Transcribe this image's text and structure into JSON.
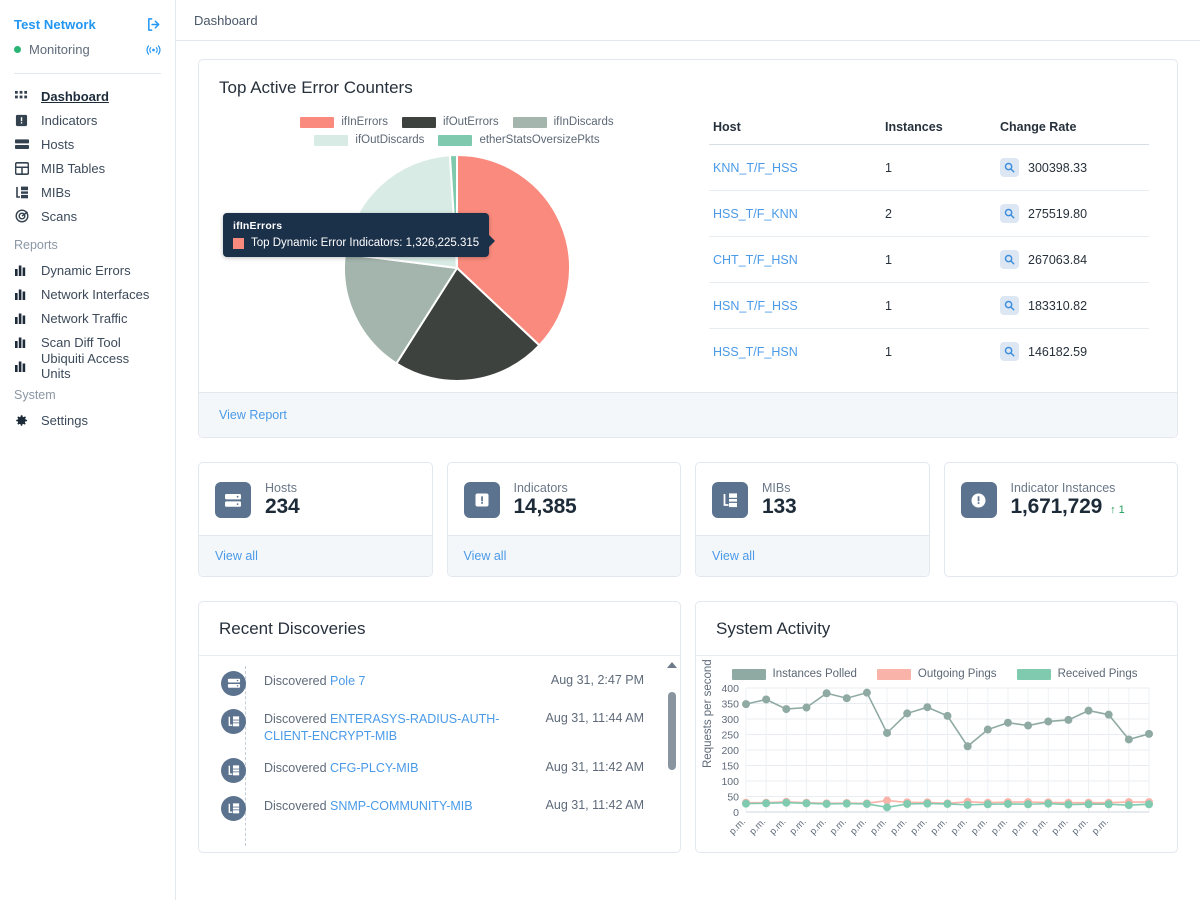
{
  "sidebar": {
    "network_name": "Test Network",
    "logout_icon": "logout-icon",
    "status_label": "Monitoring",
    "status_color": "#29b473",
    "broadcast_icon": "broadcast-icon",
    "items": [
      {
        "label": "Dashboard",
        "icon": "grid-icon",
        "active": true
      },
      {
        "label": "Indicators",
        "icon": "alert-square-icon",
        "active": false
      },
      {
        "label": "Hosts",
        "icon": "server-icon",
        "active": false
      },
      {
        "label": "MIB Tables",
        "icon": "table-icon",
        "active": false
      },
      {
        "label": "MIBs",
        "icon": "tree-icon",
        "active": false
      },
      {
        "label": "Scans",
        "icon": "radar-icon",
        "active": false
      }
    ],
    "group_reports": "Reports",
    "reports": [
      {
        "label": "Dynamic Errors",
        "icon": "bar-chart-icon"
      },
      {
        "label": "Network Interfaces",
        "icon": "bar-chart-icon"
      },
      {
        "label": "Network Traffic",
        "icon": "bar-chart-icon"
      },
      {
        "label": "Scan Diff Tool",
        "icon": "bar-chart-icon"
      },
      {
        "label": "Ubiquiti Access Units",
        "icon": "bar-chart-icon"
      }
    ],
    "group_system": "System",
    "system": [
      {
        "label": "Settings",
        "icon": "gear-icon"
      }
    ]
  },
  "topbar": {
    "breadcrumb": "Dashboard"
  },
  "error_card": {
    "title": "Top Active Error Counters",
    "view_report": "View Report",
    "table": {
      "headers": [
        "Host",
        "Instances",
        "Change Rate"
      ],
      "rows": [
        {
          "host": "KNN_T/F_HSS",
          "instances": "1",
          "rate": "300398.33"
        },
        {
          "host": "HSS_T/F_KNN",
          "instances": "2",
          "rate": "275519.80"
        },
        {
          "host": "CHT_T/F_HSN",
          "instances": "1",
          "rate": "267063.84"
        },
        {
          "host": "HSN_T/F_HSS",
          "instances": "1",
          "rate": "183310.82"
        },
        {
          "host": "HSS_T/F_HSN",
          "instances": "1",
          "rate": "146182.59"
        }
      ]
    },
    "tooltip": {
      "title": "ifInErrors",
      "text": "Top Dynamic Error Indicators: 1,326,225.315",
      "swatch": "#fa8a7d"
    }
  },
  "chart_data": [
    {
      "type": "pie",
      "title": "Top Active Error Counters",
      "legend_position": "top",
      "labels": [
        "ifInErrors",
        "ifOutErrors",
        "ifInDiscards",
        "ifOutDiscards",
        "etherStatsOversizePkts"
      ],
      "values": [
        37,
        22,
        18,
        22,
        1
      ],
      "colors": [
        "#fa8a7d",
        "#3d423f",
        "#a3b5ad",
        "#d9ebe5",
        "#7fcaae"
      ],
      "annotations": [
        "ifInErrors: Top Dynamic Error Indicators: 1,326,225.315"
      ]
    },
    {
      "type": "line",
      "title": "System Activity",
      "ylabel": "Requests per second",
      "xlabel": "",
      "ylim": [
        0,
        400
      ],
      "yticks": [
        0,
        50,
        100,
        150,
        200,
        250,
        300,
        350,
        400
      ],
      "grid": true,
      "legend_position": "top",
      "x": [
        "p.m.",
        "p.m.",
        "p.m.",
        "p.m.",
        "p.m.",
        "p.m.",
        "p.m.",
        "p.m.",
        "p.m.",
        "p.m.",
        "p.m.",
        "p.m.",
        "p.m.",
        "p.m.",
        "p.m.",
        "p.m.",
        "p.m.",
        "p.m.",
        "p.m."
      ],
      "series": [
        {
          "name": "Instances Polled",
          "color": "#8faaa2",
          "values": [
            348,
            363,
            332,
            337,
            383,
            367,
            385,
            255,
            318,
            338,
            310,
            212,
            266,
            288,
            279,
            292,
            297,
            327,
            314,
            234,
            252
          ]
        },
        {
          "name": "Outgoing Pings",
          "color": "#fab3a9",
          "values": [
            30,
            30,
            33,
            30,
            28,
            29,
            28,
            37,
            31,
            31,
            28,
            33,
            30,
            32,
            32,
            31,
            30,
            30,
            30,
            32,
            32
          ]
        },
        {
          "name": "Received Pings",
          "color": "#80cbb0",
          "values": [
            27,
            28,
            30,
            28,
            26,
            27,
            26,
            15,
            26,
            27,
            26,
            23,
            25,
            26,
            25,
            27,
            24,
            25,
            25,
            22,
            25
          ]
        }
      ]
    }
  ],
  "stats": [
    {
      "label": "Hosts",
      "value": "234",
      "icon": "server-icon",
      "link": "View all",
      "trend": ""
    },
    {
      "label": "Indicators",
      "value": "14,385",
      "icon": "alert-square-icon",
      "link": "View all",
      "trend": ""
    },
    {
      "label": "MIBs",
      "value": "133",
      "icon": "tree-icon",
      "link": "View all",
      "trend": ""
    },
    {
      "label": "Indicator Instances",
      "value": "1,671,729",
      "icon": "alert-circle-icon",
      "link": "",
      "trend": "↑ 1"
    }
  ],
  "discoveries": {
    "title": "Recent Discoveries",
    "items": [
      {
        "prefix": "Discovered ",
        "name": "Pole 7",
        "time": "Aug 31, 2:47 PM",
        "icon": "server-icon"
      },
      {
        "prefix": "Discovered ",
        "name": "ENTERASYS-RADIUS-AUTH-CLIENT-ENCRYPT-MIB",
        "time": "Aug 31, 11:44 AM",
        "icon": "tree-icon"
      },
      {
        "prefix": "Discovered ",
        "name": "CFG-PLCY-MIB",
        "time": "Aug 31, 11:42 AM",
        "icon": "tree-icon"
      },
      {
        "prefix": "Discovered ",
        "name": "SNMP-COMMUNITY-MIB",
        "time": "Aug 31, 11:42 AM",
        "icon": "tree-icon"
      }
    ]
  },
  "activity": {
    "title": "System Activity"
  }
}
